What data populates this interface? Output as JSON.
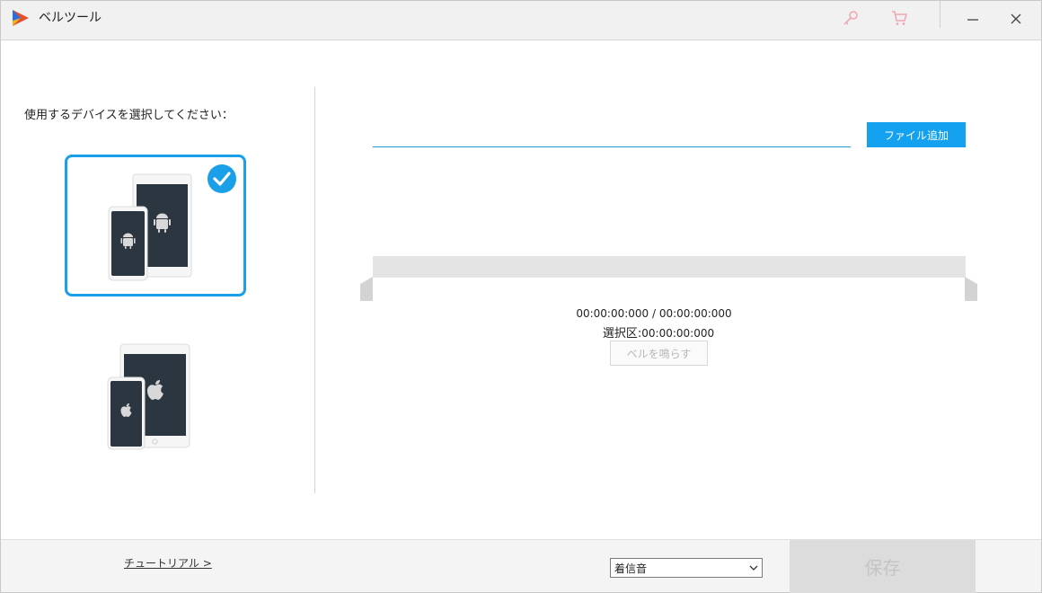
{
  "window": {
    "title": "ベルツール",
    "icons": [
      "app-logo-icon",
      "key-icon",
      "cart-icon",
      "minimize-icon",
      "close-icon"
    ]
  },
  "left_panel": {
    "prompt": "使用するデバイスを選択してください：",
    "devices": [
      {
        "name": "android",
        "icon": "android-devices-icon",
        "selected": true
      },
      {
        "name": "ios",
        "icon": "apple-devices-icon",
        "selected": false
      }
    ]
  },
  "right_panel": {
    "file_path": "",
    "add_file_label": "ファイル追加",
    "time": "00:00:00:000 / 00:00:00:000",
    "selection_label": "選択区:",
    "selection_value": "00:00:00:000",
    "ring_button_label": "ベルを鳴らす"
  },
  "footer": {
    "tutorial_label": "チュートリアル >",
    "ringtone_type": "着信音",
    "save_label": "保存"
  },
  "colors": {
    "accent": "#14a1ef",
    "selection_border": "#1aa0e8",
    "device_screen": "#2b3640",
    "disabled_text": "#b8b8b8"
  }
}
